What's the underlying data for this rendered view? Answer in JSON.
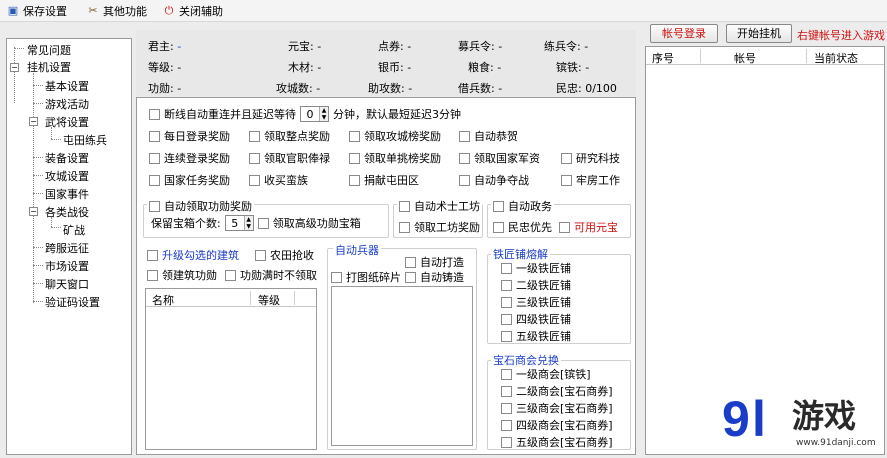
{
  "toolbar": {
    "save": "保存设置",
    "other": "其他功能",
    "close": "关闭辅助"
  },
  "tree": {
    "faq": "常见问题",
    "hang": "挂机设置",
    "basic": "基本设置",
    "game_activity": "游戏活动",
    "generals": "武将设置",
    "farm_train": "屯田练兵",
    "equipment": "装备设置",
    "city_attack": "攻城设置",
    "national": "国家事件",
    "campaigns": "各类战役",
    "mine": "矿战",
    "cross_server": "跨服远征",
    "market": "市场设置",
    "chat": "聊天窗口",
    "captcha": "验证码设置"
  },
  "status": {
    "lord": "君主:",
    "lord_v": "-",
    "ingot": "元宝:",
    "ingot_v": "-",
    "ticket": "点券:",
    "ticket_v": "-",
    "recruit": "募兵令:",
    "recruit_v": "-",
    "train": "练兵令:",
    "train_v": "-",
    "level": "等级:",
    "level_v": "-",
    "wood": "木材:",
    "wood_v": "-",
    "silver": "银币:",
    "silver_v": "-",
    "grain": "粮食:",
    "grain_v": "-",
    "iron": "镔铁:",
    "iron_v": "-",
    "merit": "功勋:",
    "merit_v": "-",
    "city_count": "攻城数:",
    "city_count_v": "-",
    "assist": "助攻数:",
    "assist_v": "-",
    "borrow": "借兵数:",
    "borrow_v": "-",
    "loyalty": "民忠:",
    "loyalty_v": "0/100"
  },
  "options": {
    "reconnect": "断线自动重连并且延迟等待",
    "reconnect_value": "0",
    "reconnect_suffix": "分钟，默认最短延迟3分钟",
    "daily_login": "每日登录奖励",
    "collect_reward": "领取整点奖励",
    "city_rank": "领取攻城榜奖励",
    "auto_congrats": "自动恭贺",
    "continuous_login": "连续登录奖励",
    "official_salary": "领取官职俸禄",
    "single_challenge": "领取单挑榜奖励",
    "national_funds": "领取国家军资",
    "research": "研究科技",
    "national_task": "国家任务奖励",
    "collect_tribe": "收买蛮族",
    "donate_farm": "捐献屯田区",
    "auto_fight": "自动争夺战",
    "prison_work": "牢房工作"
  },
  "box_group": {
    "title": "自动领取功勋奖励",
    "keep_label": "保留宝箱个数:",
    "keep_value": "5",
    "advanced": "领取高级功勋宝箱"
  },
  "craft_group": {
    "title": "自动术士工坊",
    "workshop_reward": "领取工坊奖励"
  },
  "politics_group": {
    "title": "自动政务",
    "loyalty_first": "民忠优先",
    "use_ingot": "可用元宝"
  },
  "building": {
    "upgrade": "升级勾选的建筑",
    "farm_harvest": "农田抢收",
    "build_merit": "领建筑功勋",
    "merit_full": "功勋满时不领取",
    "col_name": "名称",
    "col_level": "等级"
  },
  "weapon_group": {
    "title": "自动兵器",
    "auto_forge": "自动打造",
    "fragments": "打图纸碎片",
    "auto_cast": "自动铸造"
  },
  "smith_group": {
    "title": "铁匠铺熔解",
    "items": [
      "一级铁匠铺",
      "二级铁匠铺",
      "三级铁匠铺",
      "四级铁匠铺",
      "五级铁匠铺"
    ]
  },
  "gem_group": {
    "title": "宝石商会兑换",
    "items": [
      "一级商会[镔铁]",
      "二级商会[宝石商券]",
      "三级商会[宝石商券]",
      "四级商会[宝石商券]",
      "五级商会[宝石商券]"
    ]
  },
  "account": {
    "login_btn": "帐号登录",
    "start_btn": "开始挂机",
    "hint": "右键帐号进入游戏",
    "col_no": "序号",
    "col_account": "帐号",
    "col_status": "当前状态"
  },
  "watermark": {
    "logo": "9",
    "logo_l": "l",
    "brand": "游戏",
    "url": "www.91danji.com"
  },
  "colors": {
    "blue": "#1a3cc8",
    "red": "#d01010"
  }
}
